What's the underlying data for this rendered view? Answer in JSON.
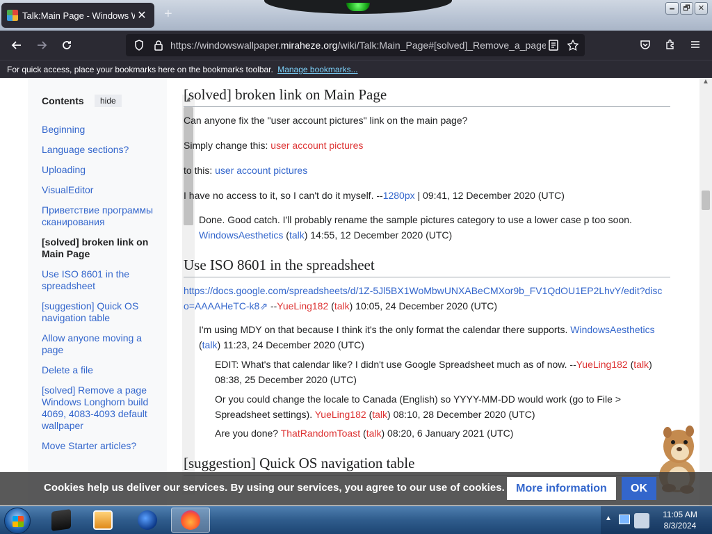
{
  "browser": {
    "tab_title": "Talk:Main Page - Windows Wall",
    "tab_close": "✕",
    "new_tab": "+",
    "url_prefix": "https://windowswallpaper.",
    "url_domain": "miraheze.org",
    "url_rest": "/wiki/Talk:Main_Page#[solved]_Remove_a_page_W",
    "window_controls": [
      "🗕",
      "🗗",
      "✕"
    ]
  },
  "bookmarks_bar": {
    "text": "For quick access, place your bookmarks here on the bookmarks toolbar.",
    "link": "Manage bookmarks..."
  },
  "toc": {
    "heading": "Contents",
    "hide": "hide",
    "items": [
      "Beginning",
      "Language sections?",
      "Uploading",
      "VisualEditor",
      "Приветствие программы сканирования",
      "[solved] broken link on Main Page",
      "Use ISO 8601 in the spreadsheet",
      "[suggestion] Quick OS navigation table",
      "Allow anyone moving a page",
      "Delete a file",
      "[solved] Remove a page Windows Longhorn build 4069, 4083-4093 default wallpaper",
      "Move Starter articles?"
    ]
  },
  "sections": {
    "s1": {
      "heading": "[solved] broken link on Main Page",
      "p1": "Can anyone fix the \"user account pictures\" link on the main page?",
      "p2_prefix": "Simply change this: ",
      "p2_link": "user account pictures",
      "p3_prefix": "to this: ",
      "p3_link": "user account pictures",
      "p4_prefix": "I have no access to it, so I can't do it myself. --",
      "p4_user": "1280px",
      "p4_suffix": " | 09:41, 12 December 2020 (UTC)",
      "reply_text": "Done. Good catch. I'll probably rename the sample pictures category to use a lower case p too soon.",
      "reply_user": "WindowsAesthetics",
      "reply_talk": "talk",
      "reply_time": " 14:55, 12 December 2020 (UTC)"
    },
    "s2": {
      "heading": "Use ISO 8601 in the spreadsheet",
      "link": "https://docs.google.com/spreadsheets/d/1Z-5Jl5BX1WoMbwUNXABeCMXor9b_FV1QdOU1EP2LhvY/edit?disco=AAAAHeTC-k8",
      "sig1_user": "YueLing182",
      "sig1_talk": "talk",
      "sig1_time": " 10:05, 24 December 2020 (UTC)",
      "r1_text": "I'm using MDY on that because I think it's the only format the calendar there supports. ",
      "r1_user": "WindowsAesthetics",
      "r1_talk": "talk",
      "r1_time": " 11:23, 24 December 2020 (UTC)",
      "r2_text": "EDIT: What's that calendar like? I didn't use Google Spreadsheet much as of now. --",
      "r2_user": "YueLing182",
      "r2_talk": "talk",
      "r2_time": "08:38, 25 December 2020 (UTC)",
      "r3_text": "Or you could change the locale to Canada (English) so YYYY-MM-DD would work (go to File > Spreadsheet settings). ",
      "r3_user": "YueLing182",
      "r3_talk": "talk",
      "r3_time": " 08:10, 28 December 2020 (UTC)",
      "r4_text": "Are you done? ",
      "r4_user": "ThatRandomToast",
      "r4_talk": "talk",
      "r4_time": " 08:20, 6 January 2021 (UTC)"
    },
    "s3": {
      "heading": "[suggestion] Quick OS navigation table"
    }
  },
  "cookie_banner": {
    "message": "Cookies help us deliver our services. By using our services, you agree to our use of cookies.",
    "more": "More information",
    "ok": "OK"
  },
  "taskbar": {
    "time": "11:05 AM",
    "date": "8/3/2024"
  },
  "colors": {
    "link": "#3366cc",
    "redlink": "#dd3333",
    "chrome": "#2b2a33"
  }
}
